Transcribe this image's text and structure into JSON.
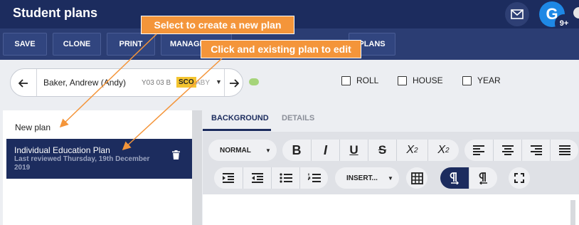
{
  "app": {
    "title": "Student plans"
  },
  "header": {
    "avatar_letter": "G",
    "notification_count": "9+"
  },
  "toolbar": {
    "buttons": [
      "SAVE",
      "CLONE",
      "PRINT",
      "MANAGE",
      "PLANS"
    ]
  },
  "student": {
    "name": "Baker, Andrew (Andy)",
    "year_group": "Y03 03 B",
    "badge": "SCO",
    "code": "ABY",
    "status_color": "#a6d47a"
  },
  "filters": [
    "ROLL",
    "HOUSE",
    "YEAR"
  ],
  "plans": {
    "new_plan_label": "New plan",
    "items": [
      {
        "title": "Individual Education Plan",
        "subtitle": "Last reviewed Thursday, 19th December 2019"
      }
    ]
  },
  "editor": {
    "tabs": [
      "BACKGROUND",
      "DETAILS"
    ],
    "style_dropdown": "NORMAL",
    "insert_dropdown": "INSERT...",
    "format_buttons": [
      "B",
      "I",
      "U",
      "S",
      "X2",
      "X2"
    ]
  },
  "annotations": {
    "callout_new": "Select to create a new plan",
    "callout_edit": "Click and existing plan to edit"
  },
  "colors": {
    "navy": "#1c2c5e",
    "accent": "#f4953a",
    "badge": "#f4c430"
  }
}
